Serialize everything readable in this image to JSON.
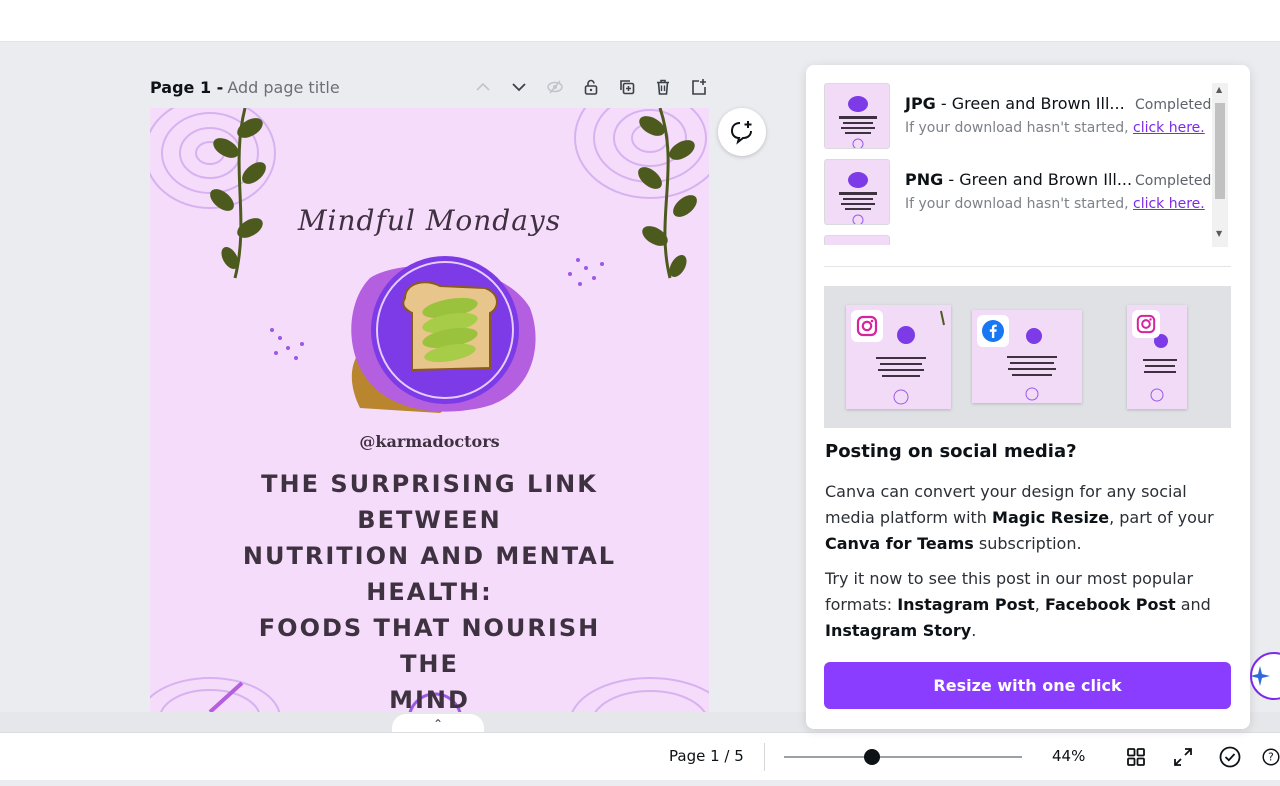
{
  "page_header": {
    "title": "Page 1 -",
    "add_title_placeholder": "Add page title",
    "tools": [
      "chevron-up",
      "chevron-down",
      "hide",
      "lock",
      "duplicate",
      "delete",
      "add-page"
    ]
  },
  "design": {
    "script_title": "Mindful Mondays",
    "handle": "@karmadoctors",
    "headline_lines": [
      "THE SURPRISING LINK",
      "BETWEEN",
      "NUTRITION AND MENTAL",
      "HEALTH:",
      "FOODS THAT NOURISH THE",
      "MIND"
    ],
    "colors": {
      "background": "#f5dcfb",
      "accent_purple": "#7c3be6",
      "leaf_green": "#4d5a1e"
    }
  },
  "downloads": [
    {
      "format": "JPG",
      "name": " - Green and Brown Ill...",
      "status": "Completed",
      "hint": "If your download hasn't started, ",
      "link": "click here."
    },
    {
      "format": "PNG",
      "name": " - Green and Brown Ill...",
      "status": "Completed",
      "hint": "If your download hasn't started, ",
      "link": "click here."
    }
  ],
  "social": {
    "heading": "Posting on social media?",
    "p1": {
      "a": "Canva can convert your design for any social media platform with ",
      "b1": "Magic Resize",
      "c": ", part of your ",
      "b2": "Canva for Teams",
      "d": " subscription."
    },
    "p2": {
      "a": "Try it now to see this post in our most popular formats: ",
      "b1": "Instagram Post",
      "c": ", ",
      "b2": "Facebook Post",
      "d": " and ",
      "b3": "Instagram Story",
      "e": "."
    },
    "button": "Resize with one click"
  },
  "bottom": {
    "page": "Page 1 / 5",
    "zoom": "44%",
    "zoom_level": 0.37
  },
  "brand_color": "#8b3dff"
}
